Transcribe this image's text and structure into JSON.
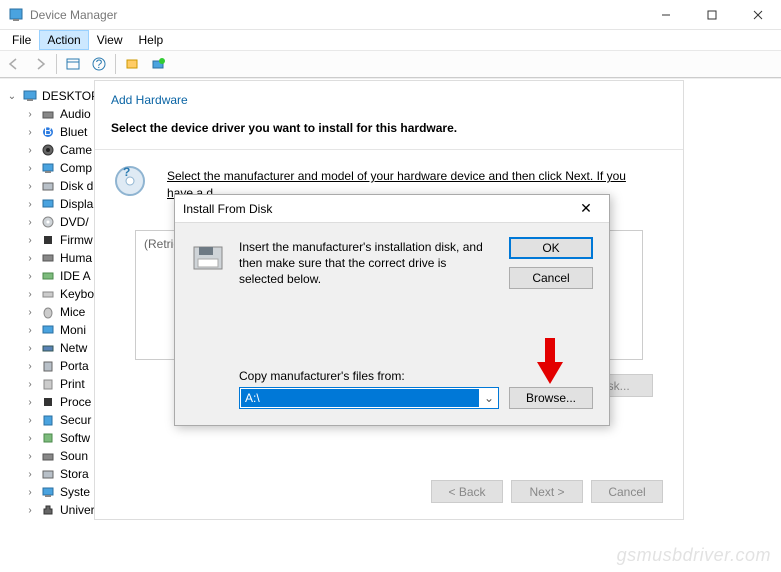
{
  "window": {
    "title": "Device Manager",
    "menu": [
      "File",
      "Action",
      "View",
      "Help"
    ],
    "active_menu_index": 1
  },
  "tree": {
    "root": "DESKTOP",
    "items": [
      "Audio",
      "Bluet",
      "Came",
      "Comp",
      "Disk d",
      "Displa",
      "DVD/",
      "Firmw",
      "Huma",
      "IDE A",
      "Keybo",
      "Mice",
      "Moni",
      "Netw",
      "Porta",
      "Print",
      "Proce",
      "Secur",
      "Softw",
      "Soun",
      "Stora",
      "Syste",
      "Universal Serial Bus controllers"
    ]
  },
  "wizard": {
    "header": "Add Hardware",
    "title": "Select the device driver you want to install for this hardware.",
    "instruction": "Select the manufacturer and model of your hardware device and then click Next. If you have a d",
    "retrieving": "(Retrieving",
    "have_disk": "e Disk...",
    "buttons": {
      "back": "< Back",
      "next": "Next >",
      "cancel": "Cancel"
    }
  },
  "dialog": {
    "title": "Install From Disk",
    "text": "Insert the manufacturer's installation disk, and then make sure that the correct drive is selected below.",
    "ok": "OK",
    "cancel": "Cancel",
    "copy_label": "Copy manufacturer's files from:",
    "path_value": "A:\\",
    "browse": "Browse..."
  },
  "watermark": "gsmusbdriver.com"
}
